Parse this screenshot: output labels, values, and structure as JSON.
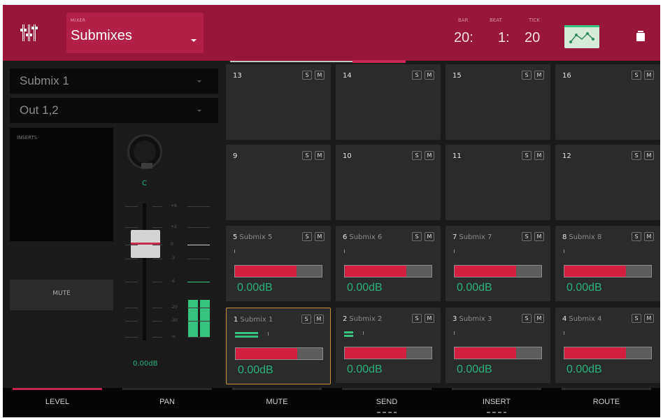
{
  "header": {
    "mode_caption": "MIXER",
    "mode_value": "Submixes",
    "position": {
      "bar_caption": "BAR",
      "beat_caption": "BEAT",
      "tick_caption": "TICK",
      "bar": "20:",
      "beat": "1:",
      "tick": "20"
    },
    "automation_icon": "automation-icon",
    "menu_icon": "menu-icon"
  },
  "left_panel": {
    "track_select": "Submix 1",
    "output_select": "Out 1,2",
    "inserts_label": "INSERTS",
    "mute_label": "MUTE",
    "pan_value": "C",
    "level_value": "0.00dB",
    "scale": [
      "+6",
      "+2",
      "0",
      "-3",
      "-6",
      "-20",
      "-30",
      "-∞"
    ]
  },
  "pads": [
    {
      "num": "13",
      "name": ""
    },
    {
      "num": "14",
      "name": ""
    },
    {
      "num": "15",
      "name": ""
    },
    {
      "num": "16",
      "name": ""
    },
    {
      "num": "9",
      "name": ""
    },
    {
      "num": "10",
      "name": ""
    },
    {
      "num": "11",
      "name": ""
    },
    {
      "num": "12",
      "name": ""
    },
    {
      "num": "5",
      "name": "Submix 5",
      "db": "0.00dB",
      "fill": 0.71
    },
    {
      "num": "6",
      "name": "Submix 6",
      "db": "0.00dB",
      "fill": 0.71
    },
    {
      "num": "7",
      "name": "Submix 7",
      "db": "0.00dB",
      "fill": 0.71
    },
    {
      "num": "8",
      "name": "Submix 8",
      "db": "0.00dB",
      "fill": 0.71
    },
    {
      "num": "1",
      "name": "Submix 1",
      "db": "0.00dB",
      "fill": 0.71,
      "selected": true,
      "meter": 0.26
    },
    {
      "num": "2",
      "name": "Submix 2",
      "db": "0.00dB",
      "fill": 0.71,
      "meter": 0.1
    },
    {
      "num": "3",
      "name": "Submix 3",
      "db": "0.00dB",
      "fill": 0.71
    },
    {
      "num": "4",
      "name": "Submix 4",
      "db": "0.00dB",
      "fill": 0.71
    }
  ],
  "pad_labels": {
    "solo": "S",
    "mute": "M"
  },
  "tabs": [
    {
      "label": "LEVEL",
      "active": true
    },
    {
      "label": "PAN"
    },
    {
      "label": "MUTE"
    },
    {
      "label": "SEND",
      "dots": true
    },
    {
      "label": "INSERT",
      "dots": true
    },
    {
      "label": "ROUTE"
    }
  ],
  "colors": {
    "header": "#98163a",
    "accent_red": "#c4254d",
    "meter_green": "#35c37f",
    "value_green": "#2ab07a",
    "selected_outline": "#c49138"
  }
}
